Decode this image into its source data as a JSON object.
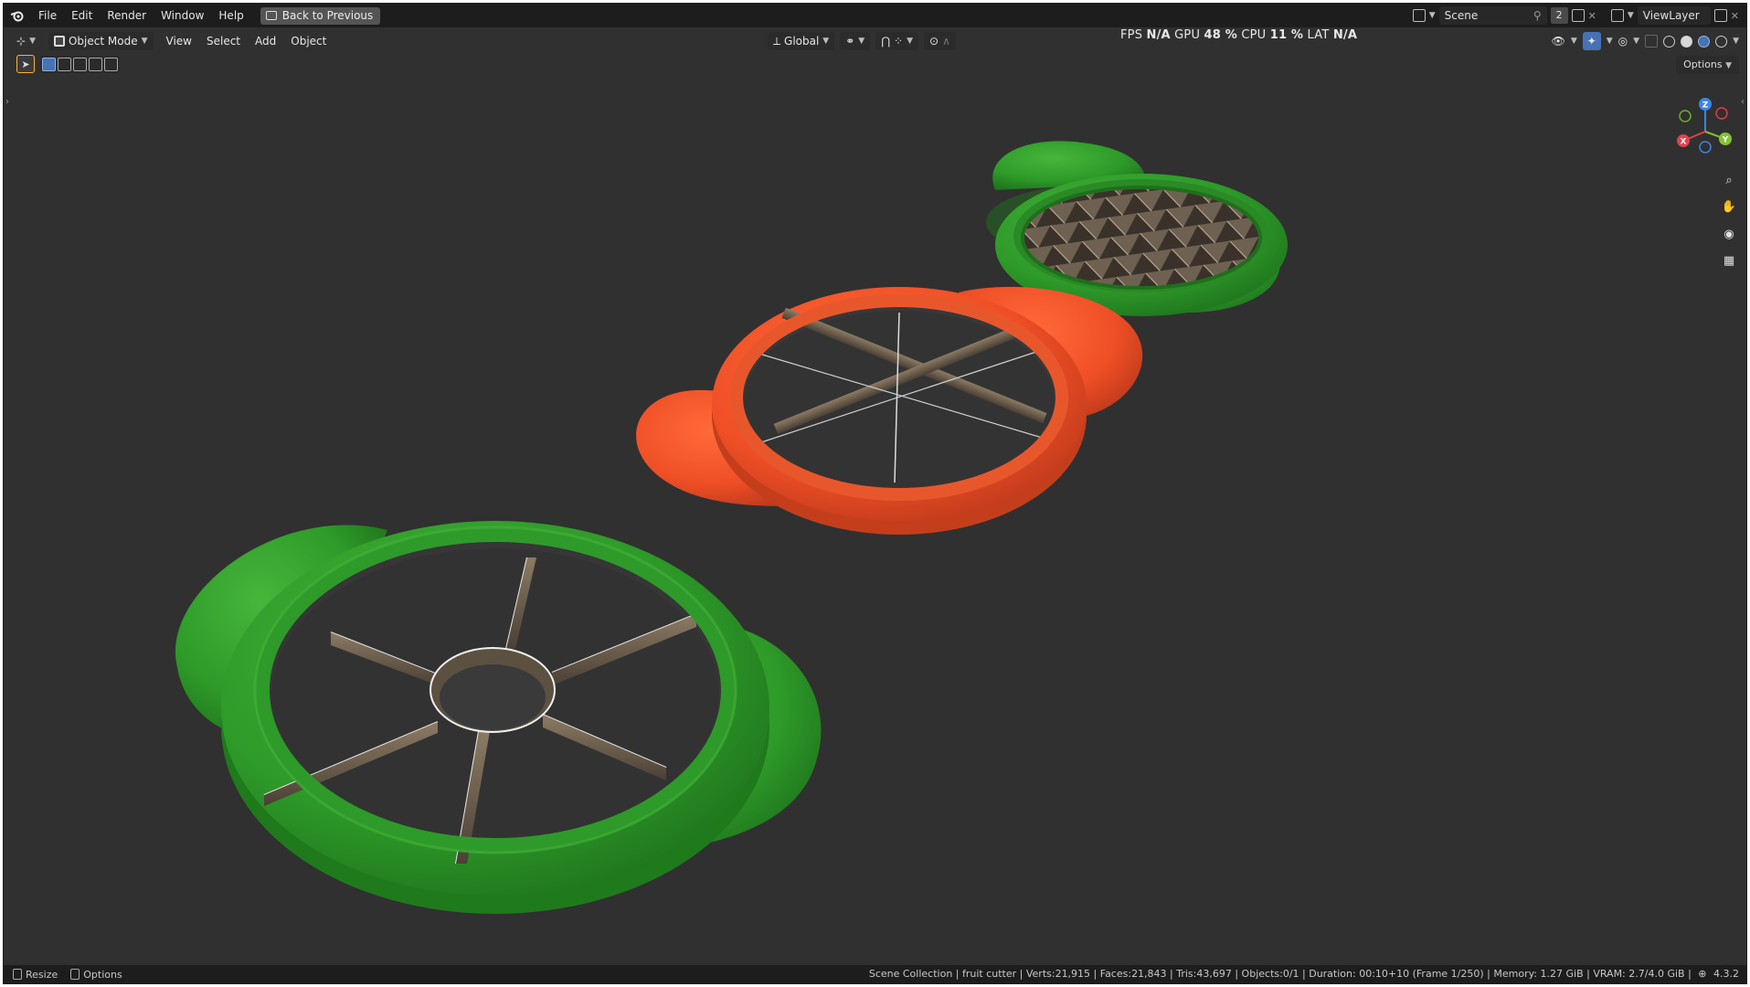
{
  "topbar": {
    "menus": [
      "File",
      "Edit",
      "Render",
      "Window",
      "Help"
    ],
    "back_button": "Back to Previous",
    "scene_name": "Scene",
    "scene_users": "2",
    "view_layer": "ViewLayer"
  },
  "header": {
    "mode": "Object Mode",
    "menus": [
      "View",
      "Select",
      "Add",
      "Object"
    ],
    "orientation": "Global",
    "options": "Options"
  },
  "stats": {
    "fps_label": "FPS",
    "fps_value": "N/A",
    "gpu_label": "GPU",
    "gpu_value": "48 %",
    "cpu_label": "CPU",
    "cpu_value": "11 %",
    "lat_label": "LAT",
    "lat_value": "N/A"
  },
  "gizmo": {
    "z": "Z",
    "y": "Y",
    "x": "X"
  },
  "statusbar": {
    "left": [
      "Resize",
      "Options"
    ],
    "info": "Scene Collection | fruit cutter | Verts:21,915 | Faces:21,843 | Tris:43,697 | Objects:0/1 | Duration: 00:10+10 (Frame 1/250) | Memory: 1.27 GiB | VRAM: 2.7/4.0 GiB |",
    "version": "4.3.2"
  },
  "colors": {
    "background": "#303030",
    "cutter_green": "#2f9a2a",
    "cutter_orange": "#f05028",
    "blade": "#7a6a55",
    "accent": "#4772b3"
  }
}
